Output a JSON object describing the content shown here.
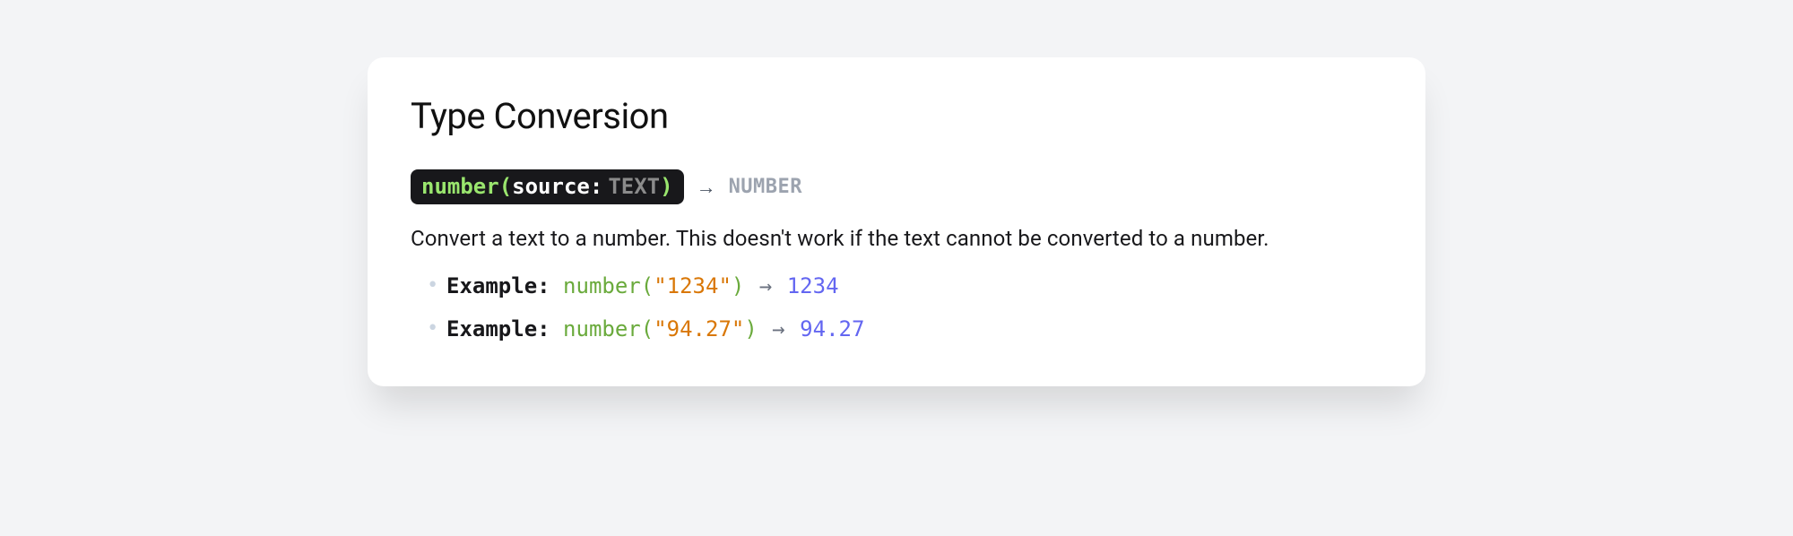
{
  "heading": "Type Conversion",
  "signature": {
    "fn": "number",
    "open": "(",
    "argname": "source:",
    "argtype": " TEXT",
    "close": ")",
    "arrow": "→",
    "returns": "NUMBER"
  },
  "description": "Convert a text to a number. This doesn't work if the text cannot be converted to a number.",
  "example_label": "Example:",
  "examples": [
    {
      "fn": "number",
      "open": "(",
      "arg": "\"1234\"",
      "close": ")",
      "arrow": "→",
      "result": "1234"
    },
    {
      "fn": "number",
      "open": "(",
      "arg": "\"94.27\"",
      "close": ")",
      "arrow": "→",
      "result": "94.27"
    }
  ]
}
